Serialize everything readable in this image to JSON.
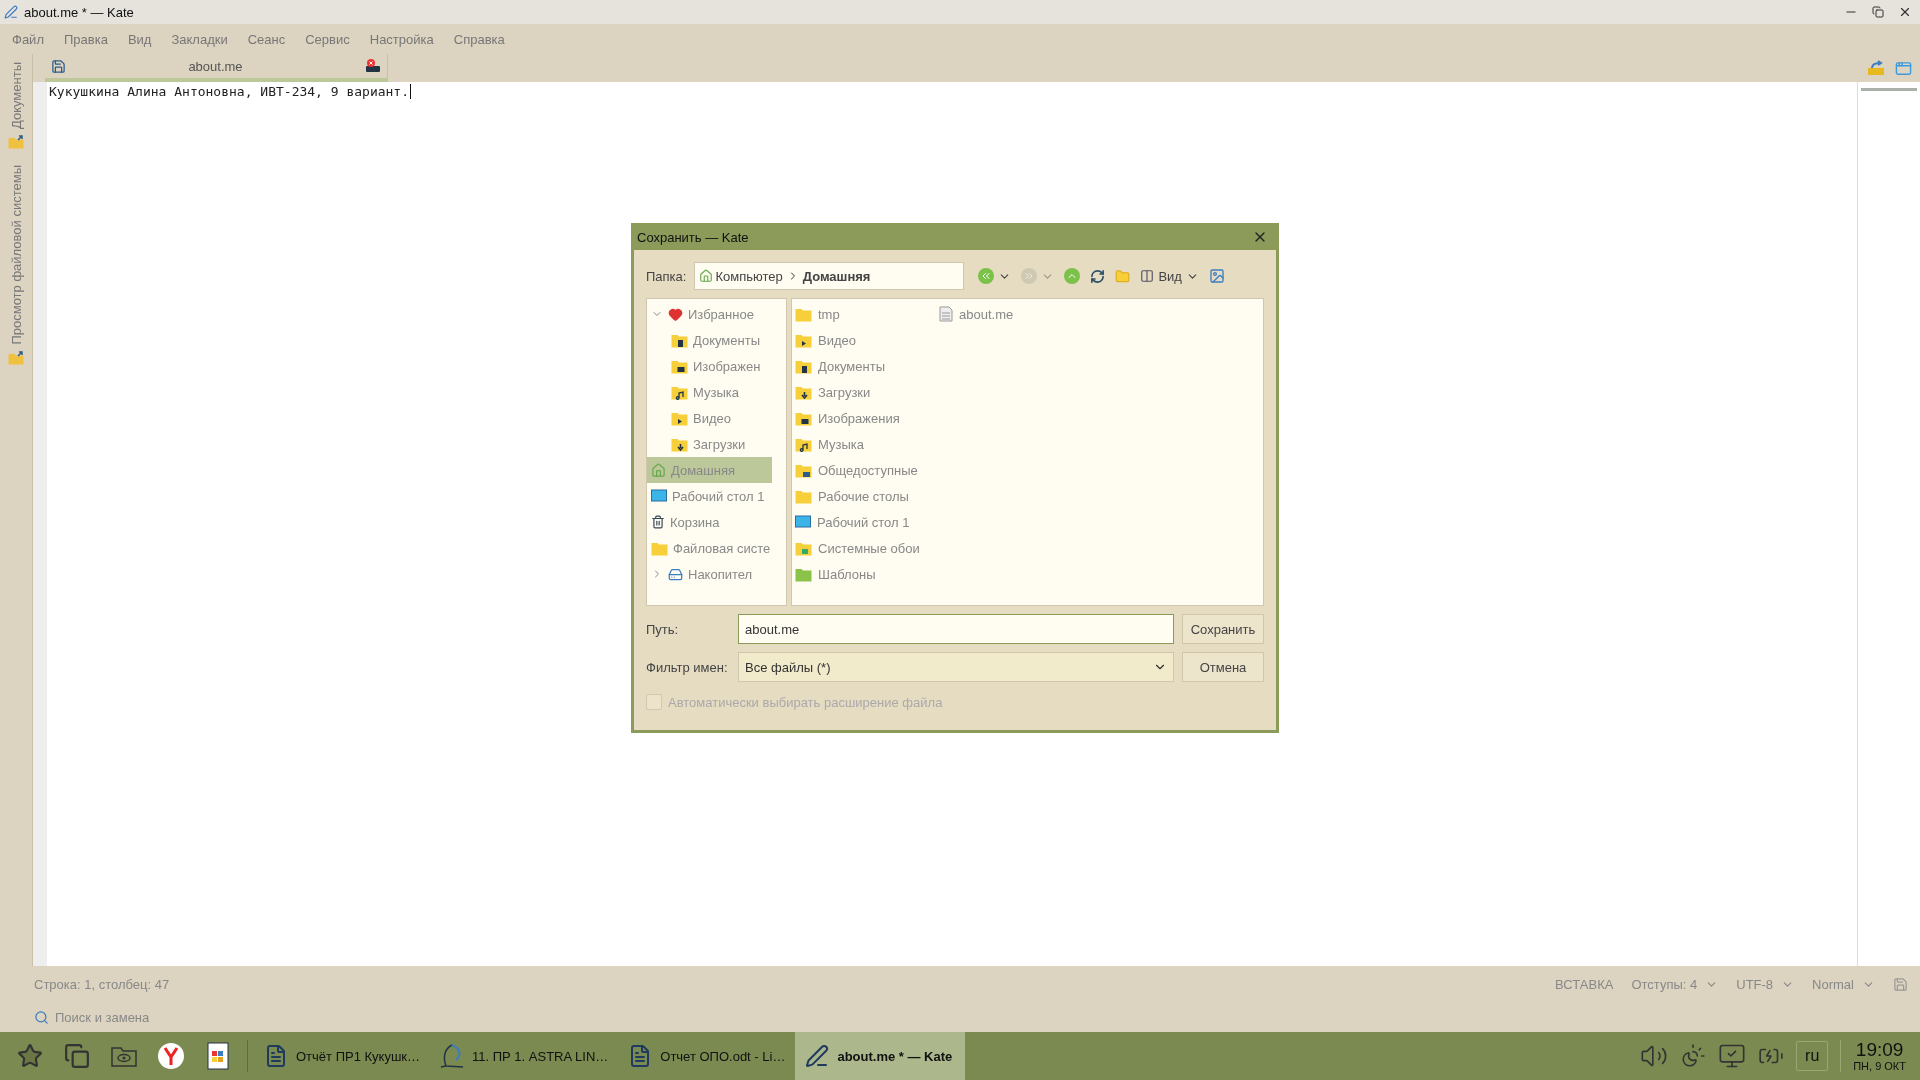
{
  "window": {
    "title": "about.me * — Kate"
  },
  "menu": [
    "Файл",
    "Правка",
    "Вид",
    "Закладки",
    "Сеанс",
    "Сервис",
    "Настройка",
    "Справка"
  ],
  "side_tabs": [
    {
      "label": "Документы",
      "selected": false
    },
    {
      "label": "Просмотр файловой системы",
      "selected": false
    }
  ],
  "doc_tabs": [
    {
      "label": "about.me",
      "selected": true
    }
  ],
  "editor": {
    "lines": [
      "Кукушкина Алина Антоновна, ИВТ-234, 9 вариант."
    ]
  },
  "dialog": {
    "title": "Сохранить — Kate",
    "folder_label": "Папка:",
    "breadcrumb": [
      "Компьютер",
      "Домашняя"
    ],
    "toolbar": [
      {
        "kind": "back",
        "disabled": false
      },
      {
        "kind": "forward",
        "disabled": true
      },
      {
        "kind": "up",
        "disabled": false
      },
      {
        "kind": "reload",
        "disabled": false
      },
      {
        "kind": "new-folder",
        "disabled": false
      },
      {
        "kind": "view",
        "label": "Вид",
        "disabled": false
      },
      {
        "kind": "preview",
        "disabled": false
      }
    ],
    "places": [
      {
        "label": "Избранное",
        "kind": "favorites",
        "expanded": true,
        "selected": false,
        "children": [
          {
            "label": "Документы",
            "kind": "documents",
            "selected": false
          },
          {
            "label": "Изображен",
            "kind": "pictures",
            "selected": false
          },
          {
            "label": "Музыка",
            "kind": "music",
            "selected": false
          },
          {
            "label": "Видео",
            "kind": "video",
            "selected": false
          },
          {
            "label": "Загрузки",
            "kind": "downloads",
            "selected": false
          }
        ]
      },
      {
        "label": "Домашняя",
        "kind": "home",
        "selected": true
      },
      {
        "label": "Рабочий стол 1",
        "kind": "desktop",
        "selected": false
      },
      {
        "label": "Корзина",
        "kind": "trash",
        "selected": false
      },
      {
        "label": "Файловая систе",
        "kind": "filesystem",
        "selected": false
      },
      {
        "label": "Накопител",
        "kind": "drives",
        "expanded": false,
        "selected": false
      }
    ],
    "files": [
      {
        "label": "tmp",
        "kind": "folder"
      },
      {
        "label": "Видео",
        "kind": "video"
      },
      {
        "label": "Документы",
        "kind": "documents"
      },
      {
        "label": "Загрузки",
        "kind": "downloads"
      },
      {
        "label": "Изображения",
        "kind": "pictures"
      },
      {
        "label": "Музыка",
        "kind": "music"
      },
      {
        "label": "Общедоступные",
        "kind": "public"
      },
      {
        "label": "Рабочие столы",
        "kind": "folder"
      },
      {
        "label": "Рабочий стол 1",
        "kind": "desktop"
      },
      {
        "label": "Системные обои",
        "kind": "wallpapers"
      },
      {
        "label": "Шаблоны",
        "kind": "templates"
      },
      {
        "label": "about.me",
        "kind": "file"
      }
    ],
    "path_label": "Путь:",
    "path_value": "about.me",
    "save_button": "Сохранить",
    "filter_label": "Фильтр имен:",
    "filter_value": "Все файлы (*)",
    "cancel_button": "Отмена",
    "auto_extension": {
      "label": "Автоматически выбирать расширение файла",
      "checked": false,
      "disabled": true
    }
  },
  "status_bar": {
    "position": "Строка: 1, столбец: 47",
    "mode": "ВСТАВКА",
    "indent": "Отступы: 4",
    "encoding": "UTF-8",
    "highlighting": "Normal"
  },
  "search_bar": {
    "label": "Поиск и замена"
  },
  "taskbar": {
    "tasks": [
      {
        "label": "Отчёт ПР1 Кукушк…",
        "kind": "document",
        "selected": false
      },
      {
        "label": "11. ПР 1. ASTRA LIN…",
        "kind": "astra",
        "selected": false
      },
      {
        "label": "Отчет ОПО.odt - Li…",
        "kind": "document",
        "selected": false
      },
      {
        "label": "about.me * — Kate",
        "kind": "editor",
        "selected": true
      }
    ],
    "language": "ru",
    "time": "19:09",
    "date": "ПН, 9 ОКТ"
  }
}
